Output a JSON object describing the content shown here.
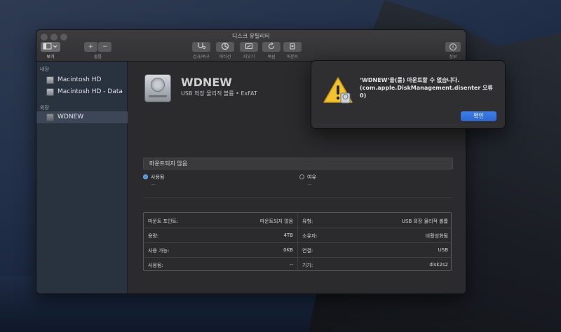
{
  "window": {
    "title": "디스크 유틸리티"
  },
  "toolbar": {
    "view_label": "보기",
    "volume_label": "볼륨",
    "plus_glyph": "+",
    "minus_glyph": "−",
    "first_aid_label": "검사/복구",
    "partition_label": "파티션",
    "erase_label": "지우기",
    "restore_label": "복원",
    "mount_label": "마운트",
    "info_label": "정보",
    "info_glyph": "i"
  },
  "sidebar": {
    "internal_header": "내장",
    "external_header": "외장",
    "items": [
      {
        "label": "Macintosh HD"
      },
      {
        "label": "Macintosh HD - Data"
      },
      {
        "label": "WDNEW"
      }
    ]
  },
  "volume": {
    "name": "WDNEW",
    "subtitle": "USB 외장 물리적 볼륨 • ExFAT",
    "usage_title": "마운트되지 않음",
    "used_label": "사용됨",
    "used_value": "--",
    "free_label": "여유",
    "free_value": "--"
  },
  "info": {
    "left": [
      {
        "key": "마운트 포인트:",
        "value": "마운트되지 않음"
      },
      {
        "key": "용량:",
        "value": "4TB"
      },
      {
        "key": "사용 가능:",
        "value": "0KB"
      },
      {
        "key": "사용됨:",
        "value": "--"
      }
    ],
    "right": [
      {
        "key": "유형:",
        "value": "USB 외장 물리적 볼륨"
      },
      {
        "key": "소유자:",
        "value": "비활성화됨"
      },
      {
        "key": "연결:",
        "value": "USB"
      },
      {
        "key": "기기:",
        "value": "disk2s2"
      }
    ]
  },
  "alert": {
    "message": "‘WDNEW’을(를) 마운트할 수 없습니다. (com.apple.DiskManagement.disenter 오류 0)",
    "ok_label": "확인"
  },
  "colors": {
    "accent": "#2d6fdc",
    "used_dot": "#4a90e2",
    "sidebar_bg": "#29323f",
    "window_bg": "#2b2b2d"
  }
}
